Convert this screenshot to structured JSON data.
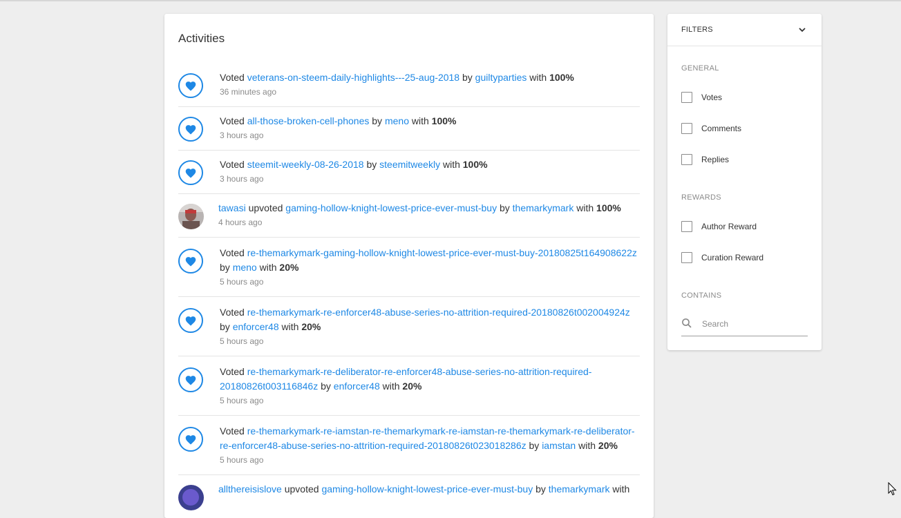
{
  "main": {
    "title": "Activities",
    "items": [
      {
        "type": "vote",
        "prefix": "Voted",
        "post": "veterans-on-steem-daily-highlights---25-aug-2018",
        "by": "by",
        "author": "guiltyparties",
        "with": "with",
        "weight": "100%",
        "time": "36 minutes ago"
      },
      {
        "type": "vote",
        "prefix": "Voted",
        "post": "all-those-broken-cell-phones",
        "by": "by",
        "author": "meno",
        "with": "with",
        "weight": "100%",
        "time": "3 hours ago"
      },
      {
        "type": "vote",
        "prefix": "Voted",
        "post": "steemit-weekly-08-26-2018",
        "by": "by",
        "author": "steemitweekly",
        "with": "with",
        "weight": "100%",
        "time": "3 hours ago"
      },
      {
        "type": "upvote",
        "voter": "tawasi",
        "prefix": "upvoted",
        "post": "gaming-hollow-knight-lowest-price-ever-must-buy",
        "by": "by",
        "author": "themarkymark",
        "with": "with",
        "weight": "100%",
        "time": "4 hours ago"
      },
      {
        "type": "vote",
        "prefix": "Voted",
        "post": "re-themarkymark-gaming-hollow-knight-lowest-price-ever-must-buy-20180825t164908622z",
        "by": "by",
        "author": "meno",
        "with": "with",
        "weight": "20%",
        "time": "5 hours ago"
      },
      {
        "type": "vote",
        "prefix": "Voted",
        "post": "re-themarkymark-re-enforcer48-abuse-series-no-attrition-required-20180826t002004924z",
        "by": "by",
        "author": "enforcer48",
        "with": "with",
        "weight": "20%",
        "time": "5 hours ago"
      },
      {
        "type": "vote",
        "prefix": "Voted",
        "post": "re-themarkymark-re-deliberator-re-enforcer48-abuse-series-no-attrition-required-20180826t003116846z",
        "by": "by",
        "author": "enforcer48",
        "with": "with",
        "weight": "20%",
        "time": "5 hours ago"
      },
      {
        "type": "vote",
        "prefix": "Voted",
        "post": "re-themarkymark-re-iamstan-re-themarkymark-re-iamstan-re-themarkymark-re-deliberator-re-enforcer48-abuse-series-no-attrition-required-20180826t023018286z",
        "by": "by",
        "author": "iamstan",
        "with": "with",
        "weight": "20%",
        "time": "5 hours ago"
      },
      {
        "type": "upvote",
        "voter": "allthereisislove",
        "prefix": "upvoted",
        "post": "gaming-hollow-knight-lowest-price-ever-must-buy",
        "by": "by",
        "author": "themarkymark",
        "with": "with",
        "weight": "",
        "time": ""
      }
    ]
  },
  "filters": {
    "title": "FILTERS",
    "general_label": "GENERAL",
    "votes_label": "Votes",
    "comments_label": "Comments",
    "replies_label": "Replies",
    "rewards_label": "REWARDS",
    "author_reward_label": "Author Reward",
    "curation_reward_label": "Curation Reward",
    "contains_label": "CONTAINS",
    "search_placeholder": "Search"
  },
  "colors": {
    "accent": "#1e88e5",
    "background": "#eeeeee",
    "card": "#ffffff"
  }
}
